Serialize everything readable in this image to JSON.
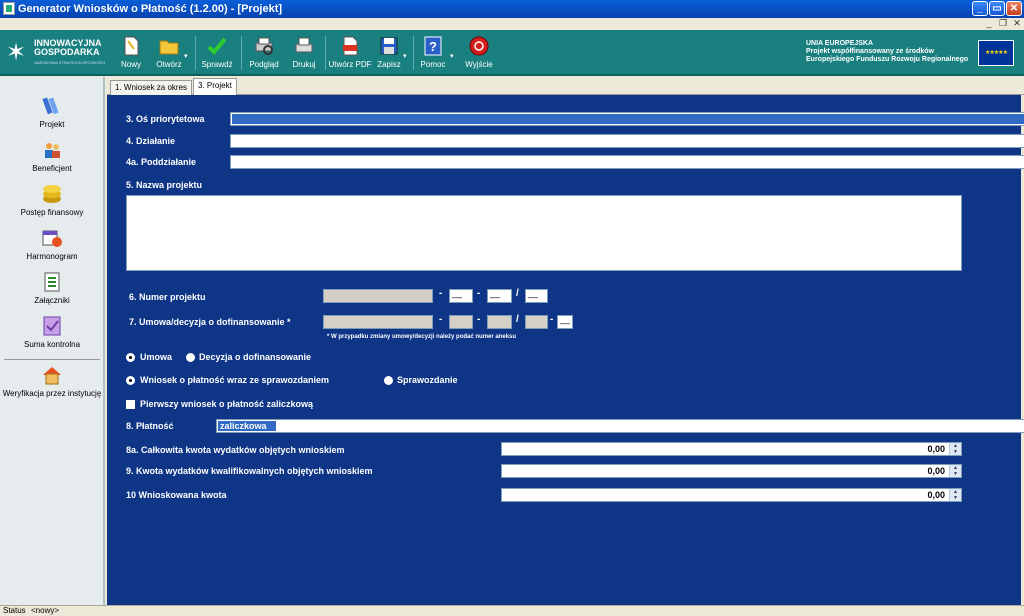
{
  "window": {
    "title": "Generator Wniosków o Płatność (1.2.00) - [Projekt]"
  },
  "logo": {
    "line1": "INNOWACYJNA",
    "line2": "GOSPODARKA",
    "line3": "NARODOWA STRATEGIA SPÓJNOŚCI"
  },
  "toolbar": {
    "items": [
      {
        "label": "Nowy",
        "icon": "new-document-icon"
      },
      {
        "label": "Otwórz",
        "icon": "folder-open-icon"
      },
      {
        "label": "Sprawdź",
        "icon": "checkmark-icon"
      },
      {
        "label": "Podgląd",
        "icon": "print-preview-icon"
      },
      {
        "label": "Drukuj",
        "icon": "printer-icon"
      },
      {
        "label": "Utwórz PDF",
        "icon": "pdf-icon"
      },
      {
        "label": "Zapisz",
        "icon": "floppy-disk-icon"
      },
      {
        "label": "Pomoc",
        "icon": "help-icon"
      },
      {
        "label": "Wyjście",
        "icon": "exit-icon"
      }
    ]
  },
  "eu": {
    "line1": "UNIA EUROPEJSKA",
    "line2": "Projekt współfinansowany ze środków",
    "line3": "Europejskiego Funduszu Rozwoju Regionalnego"
  },
  "sidebar": {
    "items": [
      {
        "label": "Projekt",
        "icon": "books-icon"
      },
      {
        "label": "Beneficjent",
        "icon": "people-icon"
      },
      {
        "label": "Postęp finansowy",
        "icon": "coins-icon"
      },
      {
        "label": "Harmonogram",
        "icon": "calendar-clock-icon"
      },
      {
        "label": "Załączniki",
        "icon": "attachments-icon"
      },
      {
        "label": "Suma kontrolna",
        "icon": "checksum-icon"
      },
      {
        "label": "Weryfikacja przez instytucję",
        "icon": "house-icon"
      }
    ]
  },
  "tabs": [
    {
      "label": "1. Wniosek za okres"
    },
    {
      "label": "3. Projekt"
    }
  ],
  "form": {
    "os_label": "3. Oś priorytetowa",
    "dzialanie_label": "4. Działanie",
    "poddzialanie_label": "4a. Poddziałanie",
    "nazwa_label": "5. Nazwa projektu",
    "numer_label": "6. Numer projektu",
    "umowa_label": "7. Umowa/decyzja o dofinansowanie *",
    "dash": "-",
    "slash": "/",
    "underscore": "__",
    "note": "* W przypadku zmiany umowy/decyzji należy podać numer aneksu",
    "radio_umowa": "Umowa",
    "radio_decyzja": "Decyzja o dofinansowanie",
    "radio_wniosek": "Wniosek o płatność wraz ze sprawozdaniem",
    "radio_sprawozdanie": "Sprawozdanie",
    "checkbox_zaliczkowy": "Pierwszy wniosek o płatność zaliczkową",
    "platnosc_label": "8. Płatność",
    "platnosc_value": "zaliczkowa",
    "kwota8a_label": "8a. Całkowita kwota wydatków objętych wnioskiem",
    "kwota8a_value": "0,00",
    "kwota9_label": "9. Kwota wydatków kwalifikowalnych objętych wnioskiem",
    "kwota9_value": "0,00",
    "kwota10_label": "10 Wnioskowana kwota",
    "kwota10_value": "0,00"
  },
  "status": {
    "label": "Status",
    "value": "<nowy>"
  }
}
